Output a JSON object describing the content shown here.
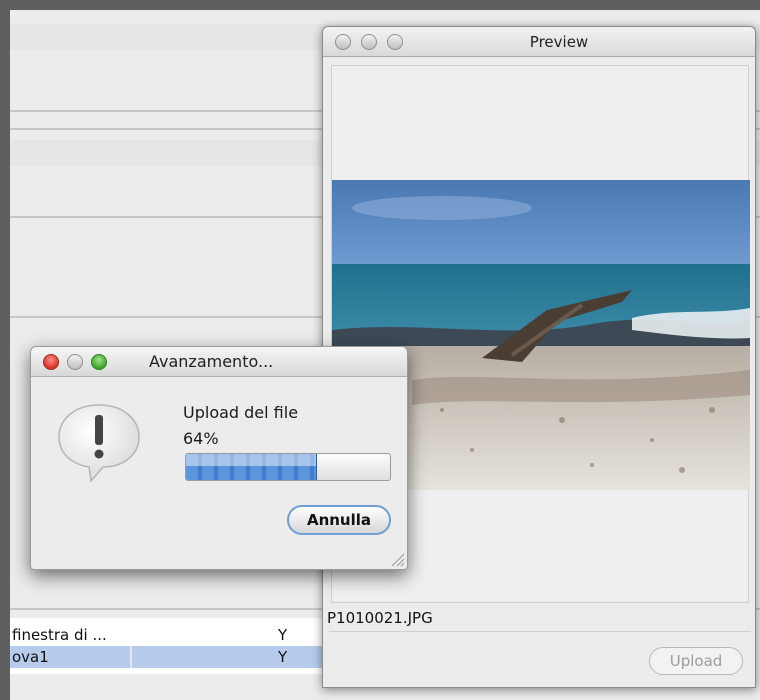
{
  "background_window": {
    "rows": [
      {
        "name": "finestra di ...",
        "flag": "Y"
      },
      {
        "name": "ova1",
        "flag": "Y"
      }
    ]
  },
  "preview": {
    "title": "Preview",
    "filename": "P1010021.JPG",
    "upload_label": "Upload"
  },
  "dialog": {
    "title": "Avanzamento...",
    "message": "Upload del file",
    "percent_text": "64%",
    "progress": 0.64,
    "cancel_label": "Annulla",
    "icon": "alert-icon"
  },
  "colors": {
    "progress_fill": "#4d88d4",
    "selection": "#b7cbec",
    "close_button": "#d8322a",
    "zoom_button": "#3ea42e"
  }
}
